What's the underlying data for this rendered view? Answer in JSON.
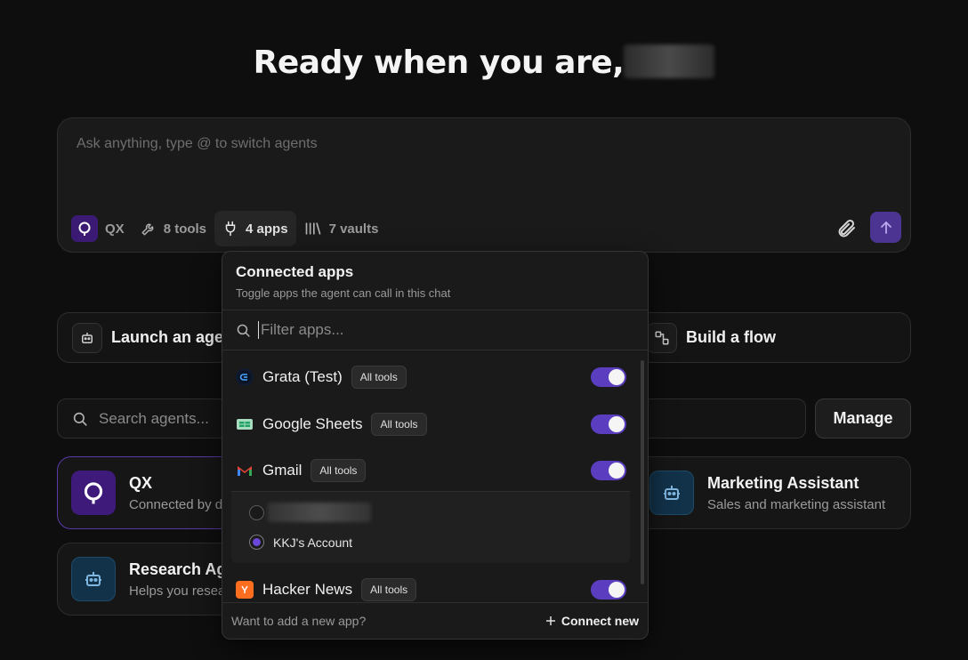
{
  "greeting": {
    "text": "Ready when you are,"
  },
  "composer": {
    "placeholder": "Ask anything, type @ to switch agents",
    "agent_chip": "QX",
    "tools_chip": "8 tools",
    "apps_chip": "4 apps",
    "vaults_chip": "7 vaults"
  },
  "actions": {
    "launch_label": "Launch an agent",
    "flow_label": "Build a flow"
  },
  "agents_search": {
    "placeholder": "Search agents...",
    "manage_label": "Manage"
  },
  "agents": [
    {
      "name": "QX",
      "description": "Connected by default"
    },
    {
      "name": "Marketing Assistant",
      "description": "Sales and marketing assistant"
    },
    {
      "name": "Research Agent",
      "description": "Helps you research"
    }
  ],
  "popup": {
    "title": "Connected apps",
    "subtitle": "Toggle apps the agent can call in this chat",
    "filter_placeholder": "Filter apps...",
    "apps": [
      {
        "name": "Grata (Test)",
        "badge": "All tools",
        "enabled": true
      },
      {
        "name": "Google Sheets",
        "badge": "All tools",
        "enabled": true
      },
      {
        "name": "Gmail",
        "badge": "All tools",
        "enabled": true
      },
      {
        "name": "Hacker News",
        "badge": "All tools",
        "enabled": true
      }
    ],
    "gmail_accounts": [
      {
        "name": "",
        "selected": false
      },
      {
        "name": "KKJ's Account",
        "selected": true
      }
    ],
    "footer_question": "Want to add a new app?",
    "connect_label": "Connect new"
  },
  "colors": {
    "accent": "#5b3ec0",
    "background": "#0e0e0e"
  }
}
